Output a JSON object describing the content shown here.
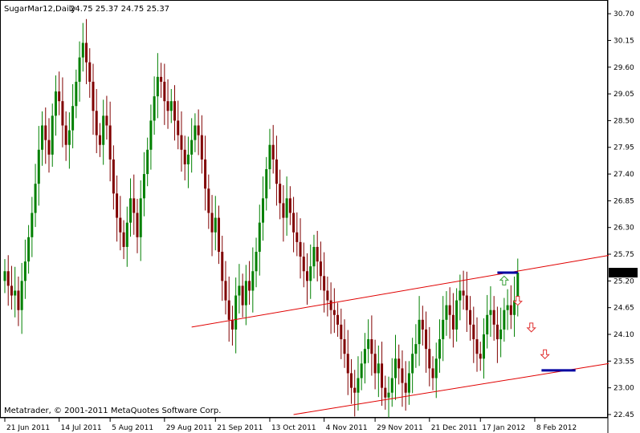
{
  "header": {
    "symbol": "SugarMar12,Daily",
    "ohlc": "24.75 25.37 24.75 25.37"
  },
  "copyright": "Metatrader, © 2001-2011 MetaQuotes Software Corp.",
  "colors": {
    "up": "#008000",
    "down": "#800000",
    "grid": "#000000",
    "trend": "#e00000",
    "level": "#0000a0",
    "arrow_up": "#3aa03a",
    "arrow_down": "#e03030"
  },
  "chart_data": {
    "type": "candlestick",
    "title": "SugarMar12,Daily",
    "ylim": [
      22.4,
      30.9
    ],
    "price_ticks": [
      "30.70",
      "30.15",
      "29.60",
      "29.05",
      "28.50",
      "27.95",
      "27.40",
      "26.85",
      "26.30",
      "25.75",
      "25.20",
      "24.65",
      "24.10",
      "23.55",
      "23.00",
      "22.45"
    ],
    "last_price": "25.37",
    "date_ticks": [
      "21 Jun 2011",
      "14 Jul 2011",
      "5 Aug 2011",
      "29 Aug 2011",
      "21 Sep 2011",
      "13 Oct 2011",
      "4 Nov 2011",
      "29 Nov 2011",
      "21 Dec 2011",
      "17 Jan 2012",
      "8 Feb 2012"
    ],
    "bars_count": 170,
    "closes": [
      25.4,
      25.1,
      24.9,
      25.0,
      24.6,
      25.2,
      25.6,
      26.1,
      26.6,
      27.2,
      27.9,
      28.4,
      28.1,
      27.8,
      28.6,
      29.1,
      28.9,
      28.4,
      28.0,
      28.3,
      28.8,
      29.3,
      29.8,
      30.1,
      29.7,
      29.3,
      28.7,
      28.2,
      28.0,
      28.6,
      28.4,
      27.7,
      27.0,
      26.5,
      26.2,
      25.9,
      26.4,
      26.9,
      26.6,
      26.1,
      26.9,
      27.4,
      27.9,
      28.5,
      29.0,
      29.4,
      29.3,
      28.9,
      28.7,
      28.9,
      28.5,
      28.2,
      27.9,
      27.6,
      27.8,
      28.1,
      28.4,
      28.2,
      27.7,
      27.1,
      26.6,
      26.2,
      26.5,
      25.8,
      25.2,
      24.8,
      24.4,
      24.2,
      24.9,
      25.1,
      24.7,
      25.2,
      25.0,
      25.4,
      25.8,
      26.4,
      26.9,
      27.5,
      28.0,
      27.7,
      27.2,
      26.8,
      26.5,
      26.9,
      26.6,
      26.2,
      26.0,
      25.7,
      25.4,
      25.2,
      25.5,
      25.9,
      25.6,
      25.3,
      25.0,
      24.8,
      24.6,
      24.5,
      24.3,
      24.0,
      23.7,
      23.3,
      23.0,
      22.9,
      23.2,
      23.5,
      23.8,
      24.0,
      23.7,
      23.3,
      23.5,
      23.0,
      22.8,
      22.9,
      23.2,
      23.6,
      23.4,
      23.1,
      22.9,
      23.3,
      23.7,
      23.9,
      24.4,
      24.2,
      23.8,
      23.4,
      23.2,
      23.6,
      24.0,
      24.4,
      24.7,
      24.5,
      24.2,
      24.8,
      25.0,
      24.9,
      24.6,
      24.3,
      24.0,
      23.7,
      23.6,
      24.1,
      24.5,
      24.6,
      24.3,
      24.0,
      24.2,
      24.6,
      24.7,
      24.5,
      24.8,
      25.37
    ],
    "trend_lines": [
      {
        "from": {
          "bar": 55,
          "price": 24.25
        },
        "to": {
          "bar": 169,
          "price": 25.62
        }
      },
      {
        "from": {
          "bar": 85,
          "price": 22.45
        },
        "to": {
          "bar": 169,
          "price": 23.4
        }
      }
    ],
    "levels": [
      {
        "from_bar": 145,
        "to_bar": 151,
        "price": 25.37
      },
      {
        "from_bar": 158,
        "to_bar": 168,
        "price": 23.36
      }
    ],
    "arrows": [
      {
        "dir": "up",
        "bar": 147,
        "price": 25.2
      },
      {
        "dir": "down",
        "bar": 151,
        "price": 24.8
      },
      {
        "dir": "down",
        "bar": 155,
        "price": 24.25
      },
      {
        "dir": "down",
        "bar": 159,
        "price": 23.7
      }
    ]
  }
}
